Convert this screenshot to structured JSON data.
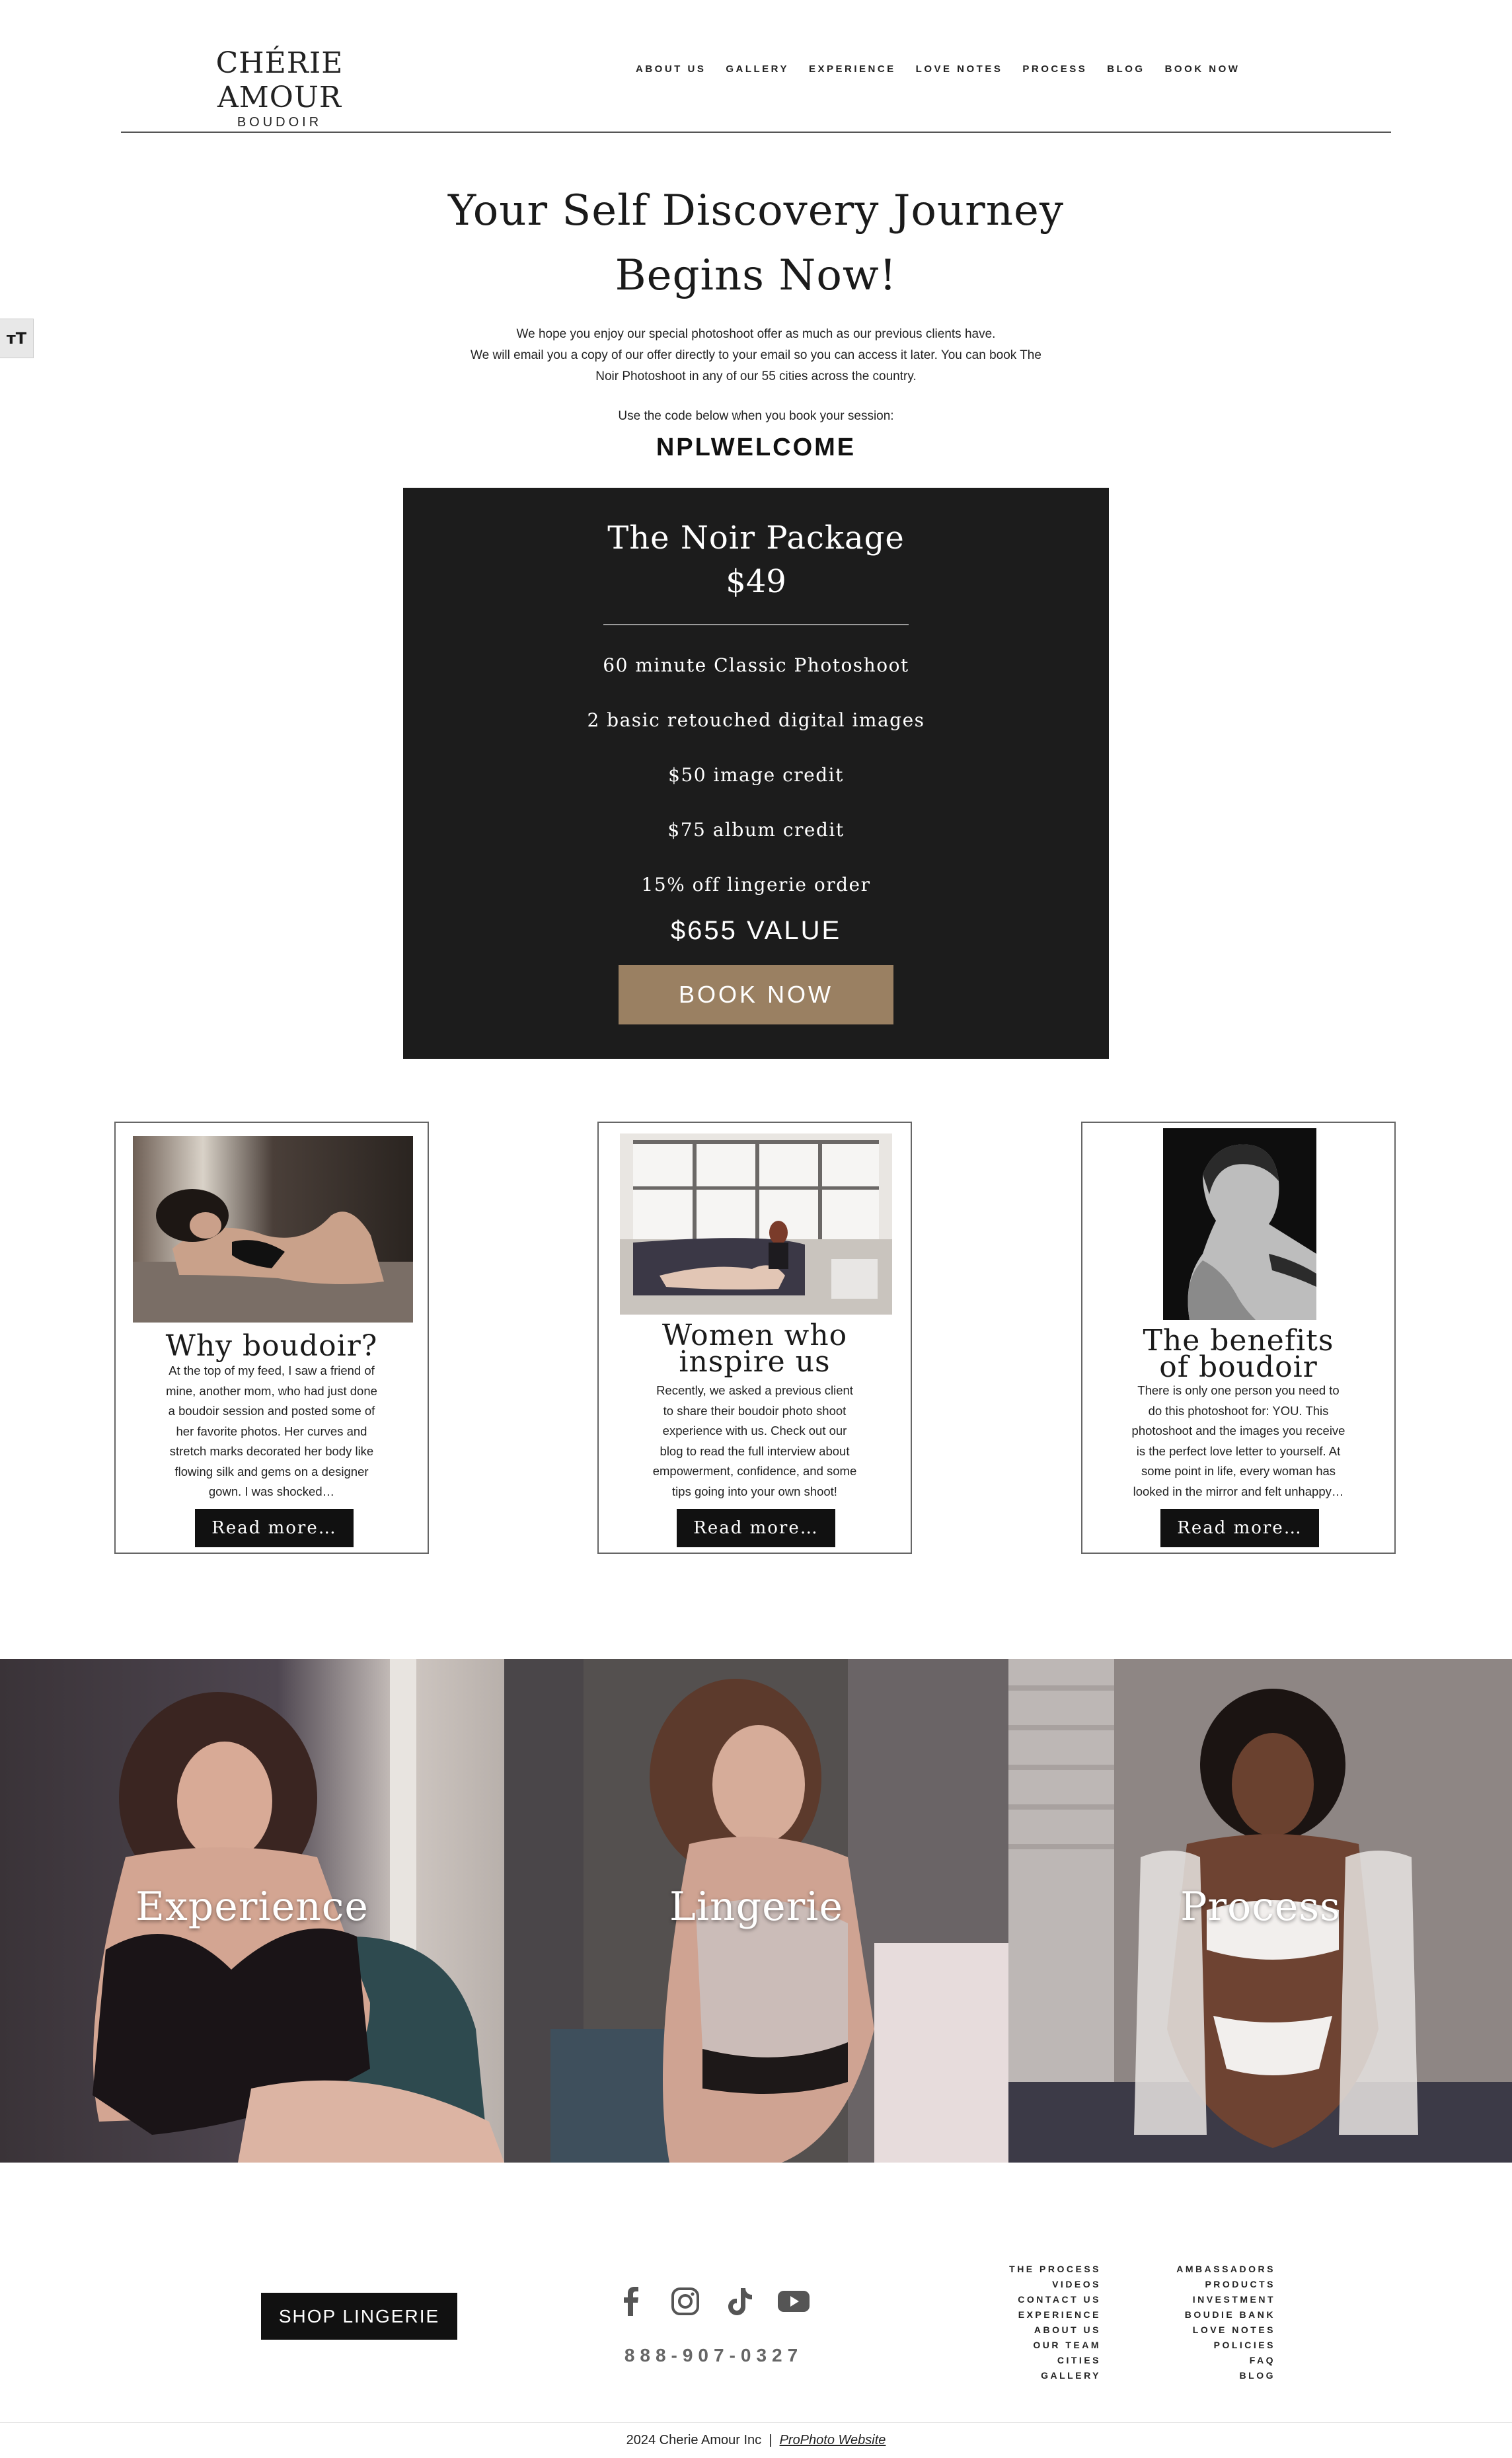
{
  "header": {
    "logo_name": "CHÉRIE AMOUR",
    "logo_sub": "BOUDOIR",
    "nav": [
      "ABOUT US",
      "GALLERY",
      "EXPERIENCE",
      "LOVE NOTES",
      "PROCESS",
      "BLOG",
      "BOOK NOW"
    ]
  },
  "a11y_label": "ᴛT",
  "hero": {
    "title_line1": "Your Self Discovery Journey",
    "title_line2": "Begins Now!",
    "intro_line1": "We hope you enjoy our special photoshoot offer as much as our previous clients have.",
    "intro_line2": "We will email you a copy of our offer directly to your email so you can access it later. You can book The",
    "intro_line3": "Noir Photoshoot in any of our 55 cities across the country.",
    "code_label": "Use the code below when you book your session:",
    "promo_code": "NPLWELCOME"
  },
  "package": {
    "title": "The Noir Package",
    "price": "$49",
    "items": [
      "60 minute Classic Photoshoot",
      "2 basic retouched digital images",
      "$50 image credit",
      "$75 album credit",
      "15% off lingerie order"
    ],
    "value": "$655  VALUE",
    "book_label": "BOOK  NOW"
  },
  "cards": [
    {
      "title_lines": [
        "Why boudoir?"
      ],
      "text_lines": [
        "At the top of my feed, I saw a friend of",
        "mine, another mom, who had just done",
        "a boudoir session and posted some of",
        "her favorite photos. Her curves and",
        "stretch marks decorated her body like",
        "flowing silk and gems on a designer",
        "gown. I was shocked…"
      ],
      "button": "Read more…"
    },
    {
      "title_lines": [
        "Women who",
        "inspire us"
      ],
      "text_lines": [
        "Recently, we asked a previous client",
        "to share their boudoir photo shoot",
        "experience with us. Check out our",
        "blog to read the full interview about",
        "empowerment, confidence, and some",
        "tips going into your own shoot!"
      ],
      "button": "Read more…"
    },
    {
      "title_lines": [
        "The benefits",
        "of boudoir"
      ],
      "text_lines": [
        "There is only one person you need to",
        "do this photoshoot for: YOU. This",
        "photoshoot and the images you receive",
        "is the perfect love letter to yourself. At",
        "some point in life, every woman has",
        "looked in the mirror and felt unhappy…"
      ],
      "button": "Read more…"
    }
  ],
  "tiles": [
    "Experience",
    "Lingerie",
    "Process"
  ],
  "footer": {
    "shop_label": "SHOP LINGERIE",
    "socials": [
      "facebook-icon",
      "instagram-icon",
      "tiktok-icon",
      "youtube-icon"
    ],
    "phone": "888-907-0327",
    "links_col1": [
      "THE PROCESS",
      "VIDEOS",
      "CONTACT US",
      "EXPERIENCE",
      "ABOUT US",
      "OUR TEAM",
      "CITIES",
      "GALLERY"
    ],
    "links_col2": [
      "AMBASSADORS",
      "PRODUCTS",
      "INVESTMENT",
      "BOUDIE BANK",
      "LOVE NOTES",
      "POLICIES",
      "FAQ",
      "BLOG"
    ],
    "copyright": "2024 Cherie Amour Inc  |  ",
    "credit_link": "ProPhoto Website"
  }
}
